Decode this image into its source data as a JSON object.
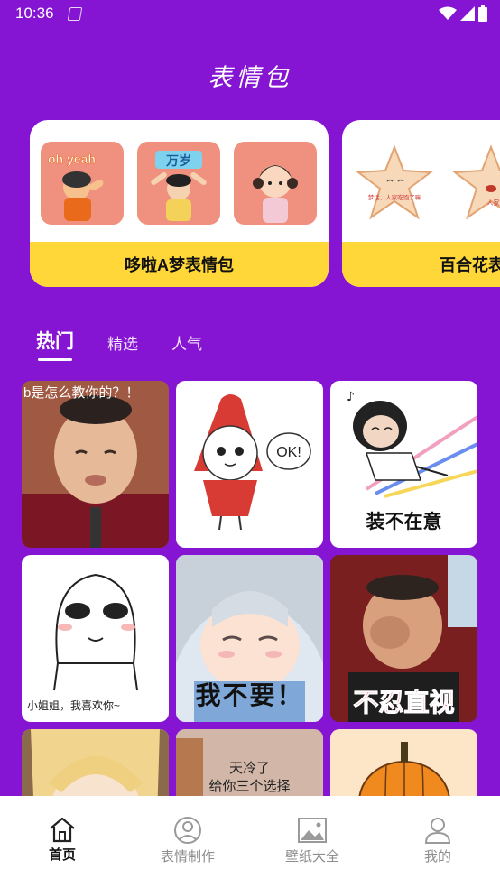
{
  "status": {
    "time": "10:36"
  },
  "app": {
    "title": "表情包"
  },
  "banners": [
    {
      "label": "哆啦A梦表情包",
      "stickers": [
        "oh yeah",
        "万岁",
        ""
      ]
    },
    {
      "label": "百合花表",
      "stickers": [
        "梦话、人家吃饱了嘛",
        "人家好"
      ]
    }
  ],
  "tabs": [
    {
      "label": "热门",
      "active": true
    },
    {
      "label": "精选",
      "active": false
    },
    {
      "label": "人气",
      "active": false
    }
  ],
  "grid": [
    {
      "caption": "b是怎么教你的？！"
    },
    {
      "caption": "OK!"
    },
    {
      "caption": "装不在意"
    },
    {
      "caption": "小姐姐，我喜欢你~"
    },
    {
      "caption": "我不要！"
    },
    {
      "caption": "不忍直视"
    },
    {
      "caption": ""
    },
    {
      "caption": "天冷了\n给你三个选择"
    },
    {
      "caption": ""
    }
  ],
  "nav": [
    {
      "label": "首页",
      "icon": "home-icon",
      "active": true
    },
    {
      "label": "表情制作",
      "icon": "smiley-icon",
      "active": false
    },
    {
      "label": "壁纸大全",
      "icon": "image-icon",
      "active": false
    },
    {
      "label": "我的",
      "icon": "user-icon",
      "active": false
    }
  ],
  "colors": {
    "background": "#8514d3",
    "accent": "#ffd738"
  }
}
